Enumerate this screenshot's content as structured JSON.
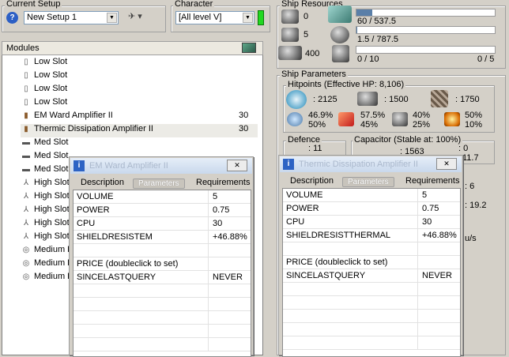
{
  "current_setup": {
    "title": "Current Setup",
    "value": "New Setup 1"
  },
  "character": {
    "title": "Character",
    "value": "[All level V]"
  },
  "modules": {
    "header": "Modules",
    "rows": [
      {
        "icon": "low-slot-icon",
        "label": "Low Slot",
        "qty": ""
      },
      {
        "icon": "low-slot-icon",
        "label": "Low Slot",
        "qty": ""
      },
      {
        "icon": "low-slot-icon",
        "label": "Low Slot",
        "qty": ""
      },
      {
        "icon": "low-slot-icon",
        "label": "Low Slot",
        "qty": ""
      },
      {
        "icon": "module-icon",
        "label": "EM Ward Amplifier II",
        "qty": "30"
      },
      {
        "icon": "module-icon",
        "label": "Thermic Dissipation Amplifier II",
        "qty": "30"
      },
      {
        "icon": "med-slot-icon",
        "label": "Med Slot",
        "qty": ""
      },
      {
        "icon": "med-slot-icon",
        "label": "Med Slot",
        "qty": ""
      },
      {
        "icon": "med-slot-icon",
        "label": "Med Slot",
        "qty": ""
      },
      {
        "icon": "high-slot-icon",
        "label": "High Slot",
        "qty": ""
      },
      {
        "icon": "high-slot-icon",
        "label": "High Slot",
        "qty": ""
      },
      {
        "icon": "high-slot-icon",
        "label": "High Slot",
        "qty": ""
      },
      {
        "icon": "high-slot-icon",
        "label": "High Slot",
        "qty": ""
      },
      {
        "icon": "high-slot-icon",
        "label": "High Slot",
        "qty": ""
      },
      {
        "icon": "rig-slot-icon",
        "label": "Medium R",
        "qty": ""
      },
      {
        "icon": "rig-slot-icon",
        "label": "Medium R",
        "qty": ""
      },
      {
        "icon": "rig-slot-icon",
        "label": "Medium R",
        "qty": ""
      }
    ]
  },
  "ship_resources": {
    "title": "Ship Resources",
    "left": [
      "0",
      "5",
      "400"
    ],
    "bars": [
      {
        "text": "60 / 537.5",
        "fraction": 0.112,
        "right": ""
      },
      {
        "text": "1.5 / 787.5",
        "fraction": 0.002,
        "right": ""
      },
      {
        "text": "0 / 10",
        "fraction": 0,
        "right": "0 / 5"
      }
    ]
  },
  "ship_parameters": {
    "title": "Ship Parameters",
    "hitpoints_title": "Hitpoints (Effective HP: 8,106)",
    "shield": ": 2125",
    "armor": ": 1500",
    "structure": ": 1750",
    "resists": [
      {
        "top": "46.9%",
        "bottom": "50%"
      },
      {
        "top": "57.5%",
        "bottom": "45%"
      },
      {
        "top": "40%",
        "bottom": "25%"
      },
      {
        "top": "50%",
        "bottom": "10%"
      }
    ],
    "defence_title": "Defence",
    "defence_value": ": 11",
    "capacitor_title": "Capacitor (Stable at: 100%)",
    "capacitor_value": ": 1563",
    "capacitor_right": ": 0",
    "cap_partial": "11.7",
    "right_vals": [
      ": 6",
      ": 19.2",
      "u/s"
    ]
  },
  "popup_left": {
    "title": "EM Ward Amplifier II",
    "tabs": [
      "Description",
      "Parameters",
      "Requirements"
    ],
    "rows": [
      {
        "k": "VOLUME",
        "v": "5"
      },
      {
        "k": "POWER",
        "v": "0.75"
      },
      {
        "k": "CPU",
        "v": "30"
      },
      {
        "k": "SHIELDRESISTEM",
        "v": "+46.88%"
      },
      {
        "k": "",
        "v": ""
      },
      {
        "k": "PRICE (doubleclick to set)",
        "v": ""
      },
      {
        "k": "SINCELASTQUERY",
        "v": "NEVER"
      }
    ]
  },
  "popup_right": {
    "title": "Thermic Dissipation Amplifier II",
    "tabs": [
      "Description",
      "Parameters",
      "Requirements"
    ],
    "rows": [
      {
        "k": "VOLUME",
        "v": "5"
      },
      {
        "k": "POWER",
        "v": "0.75"
      },
      {
        "k": "CPU",
        "v": "30"
      },
      {
        "k": "SHIELDRESISTTHERMAL",
        "v": "+46.88%"
      },
      {
        "k": "",
        "v": ""
      },
      {
        "k": "PRICE (doubleclick to set)",
        "v": ""
      },
      {
        "k": "SINCELASTQUERY",
        "v": "NEVER"
      }
    ]
  }
}
